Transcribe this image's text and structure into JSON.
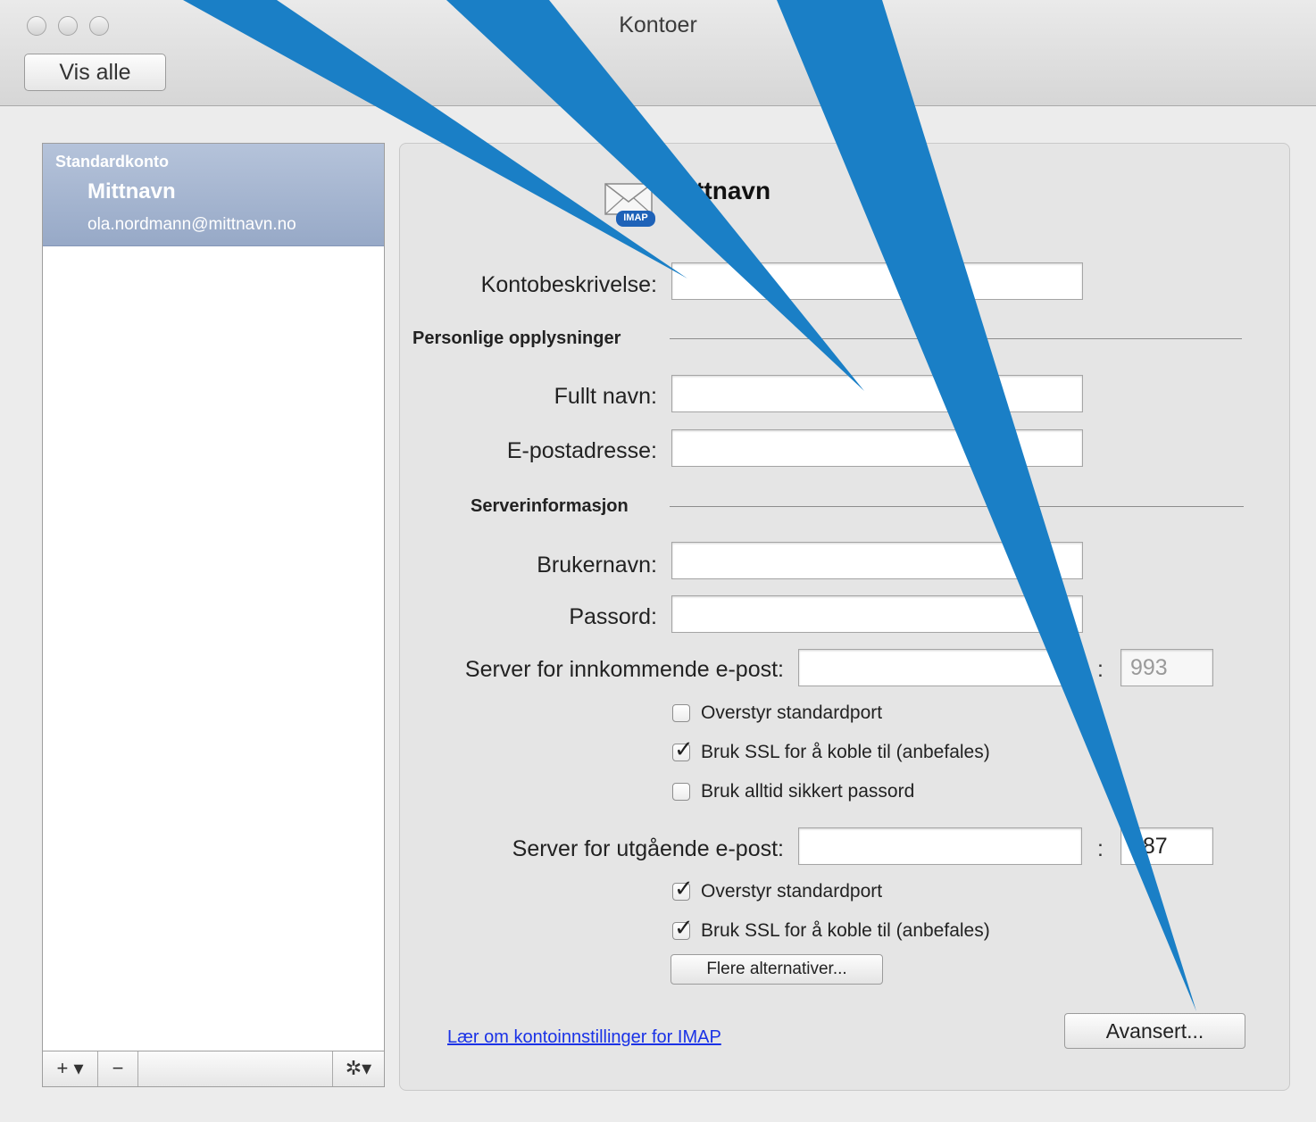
{
  "window": {
    "title": "Kontoer",
    "show_all": "Vis alle"
  },
  "sidebar": {
    "group_label": "Standardkonto",
    "account_name": "Mittnavn",
    "account_email": "ola.nordmann@mittnavn.no",
    "add_label": "+ ▾",
    "remove_label": "−",
    "gear_label": "✲▾"
  },
  "panel": {
    "account_heading": "Mittnavn",
    "icon_badge": "IMAP",
    "account_description_label": "Kontobeskrivelse:",
    "account_description_value": "",
    "personal_section": "Personlige opplysninger",
    "full_name_label": "Fullt navn:",
    "full_name_value": "",
    "email_label": "E-postadresse:",
    "email_value": "",
    "server_section": "Serverinformasjon",
    "username_label": "Brukernavn:",
    "username_value": "",
    "password_label": "Passord:",
    "password_value": "",
    "incoming_label": "Server for innkommende e-post:",
    "incoming_value": "",
    "incoming_port": "993",
    "colon": ":",
    "incoming_override_label": "Overstyr standardport",
    "incoming_override_checked": false,
    "incoming_ssl_label": "Bruk SSL for å koble til (anbefales)",
    "incoming_ssl_checked": true,
    "incoming_secure_pw_label": "Bruk alltid sikkert passord",
    "incoming_secure_pw_checked": false,
    "outgoing_label": "Server for utgående e-post:",
    "outgoing_value": "",
    "outgoing_port": "587",
    "outgoing_override_label": "Overstyr standardport",
    "outgoing_override_checked": true,
    "outgoing_ssl_label": "Bruk SSL for å koble til (anbefales)",
    "outgoing_ssl_checked": true,
    "more_options": "Flere alternativer...",
    "learn_link": "Lær om kontoinnstillinger for IMAP",
    "advanced": "Avansert...",
    "check_glyph": "✓"
  },
  "colors": {
    "callout": "#1a7fc6",
    "selection": "#9fb0cd",
    "link": "#1a32e6"
  }
}
